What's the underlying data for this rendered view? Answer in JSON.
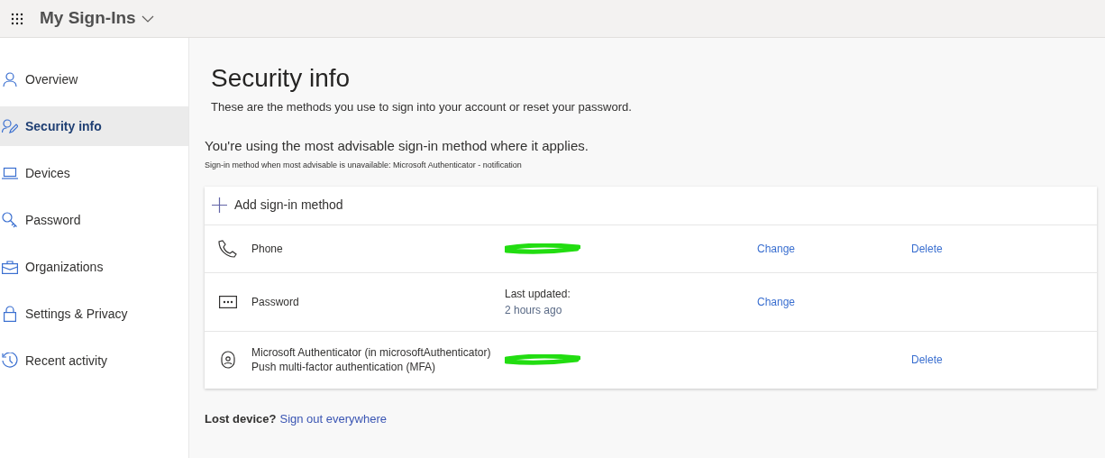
{
  "header": {
    "title": "My Sign-Ins"
  },
  "sidebar": {
    "items": [
      {
        "label": "Overview",
        "kind": "person",
        "selected": false
      },
      {
        "label": "Security info",
        "kind": "person-pen",
        "selected": true
      },
      {
        "label": "Devices",
        "kind": "laptop",
        "selected": false
      },
      {
        "label": "Password",
        "kind": "key",
        "selected": false
      },
      {
        "label": "Organizations",
        "kind": "briefcase",
        "selected": false
      },
      {
        "label": "Settings & Privacy",
        "kind": "lock",
        "selected": false
      },
      {
        "label": "Recent activity",
        "kind": "history",
        "selected": false
      }
    ]
  },
  "main": {
    "title": "Security info",
    "subtitle": "These are the methods you use to sign into your account or reset your password.",
    "advisory": "You're using the most advisable sign-in method where it applies.",
    "advisory_note": "Sign-in method when most advisable is unavailable: Microsoft Authenticator - notification",
    "add_method": "Add sign-in method",
    "methods": [
      {
        "kind": "phone",
        "name": [
          "Phone"
        ],
        "detail": {
          "kind": "redacted"
        },
        "change": "Change",
        "delete": "Delete"
      },
      {
        "kind": "password",
        "name": [
          "Password"
        ],
        "detail": {
          "kind": "text",
          "label": "Last updated:",
          "value": "2 hours ago"
        },
        "change": "Change"
      },
      {
        "kind": "authenticator",
        "name": [
          "Microsoft Authenticator (in microsoftAuthenticator)",
          "Push multi-factor authentication (MFA)"
        ],
        "detail": {
          "kind": "redacted"
        },
        "delete": "Delete"
      }
    ],
    "lost_device": {
      "label": "Lost device?",
      "link": "Sign out everywhere"
    }
  }
}
